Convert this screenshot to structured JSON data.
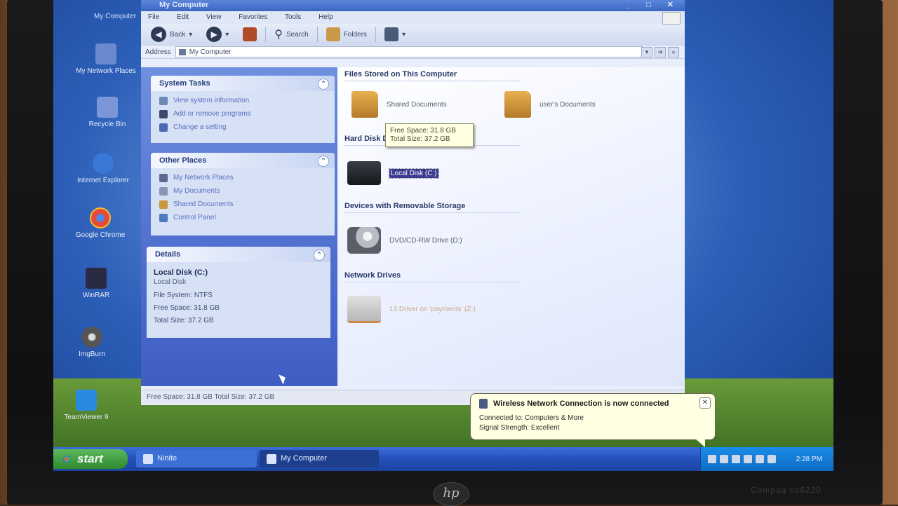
{
  "desktop": {
    "top_caption": "My Computer",
    "icons": [
      {
        "label": "My Network Places"
      },
      {
        "label": "Recycle Bin"
      },
      {
        "label": "Internet Explorer"
      },
      {
        "label": "Google Chrome"
      },
      {
        "label": "WinRAR"
      },
      {
        "label": "ImgBurn"
      },
      {
        "label": "TeamViewer 9"
      }
    ]
  },
  "window": {
    "title": "My Computer",
    "menu": [
      "File",
      "Edit",
      "View",
      "Favorites",
      "Tools",
      "Help"
    ],
    "toolbar": {
      "back": "Back",
      "search": "Search",
      "folders": "Folders"
    },
    "address": {
      "label": "Address",
      "value": "My Computer"
    }
  },
  "system_tasks": {
    "title": "System Tasks",
    "items": [
      "View system information",
      "Add or remove programs",
      "Change a setting"
    ]
  },
  "other_places": {
    "title": "Other Places",
    "items": [
      "My Network Places",
      "My Documents",
      "Shared Documents",
      "Control Panel"
    ]
  },
  "details": {
    "title": "Details",
    "name": "Local Disk (C:)",
    "kind": "Local Disk",
    "file_system": "File System: NTFS",
    "free_space": "Free Space: 31.8 GB",
    "total_size": "Total Size: 37.2 GB"
  },
  "files": {
    "groups": {
      "stored": "Files Stored on This Computer",
      "hard_disks": "Hard Disk Drives",
      "removable": "Devices with Removable Storage",
      "network": "Network Drives"
    },
    "items": {
      "shared_docs": "Shared Documents",
      "users_docs": "user's Documents",
      "local_disk": "Local Disk (C:)",
      "dvd": "DVD/CD-RW Drive (D:)",
      "net_drive": "13 Driver on 'payments' (Z:)"
    },
    "tooltip": {
      "free": "Free Space: 31.8 GB",
      "total": "Total Size: 37.2 GB"
    }
  },
  "statusbar": "Free Space: 31.8 GB Total Size: 37.2 GB",
  "balloon": {
    "title": "Wireless Network Connection is now connected",
    "line1": "Connected to: Computers & More",
    "line2": "Signal Strength: Excellent"
  },
  "taskbar": {
    "start": "start",
    "buttons": [
      "Ninite",
      "My Computer"
    ],
    "clock": "2:28 PM"
  },
  "bezel": {
    "brand": "hp",
    "model": "Compaq nc6220"
  }
}
